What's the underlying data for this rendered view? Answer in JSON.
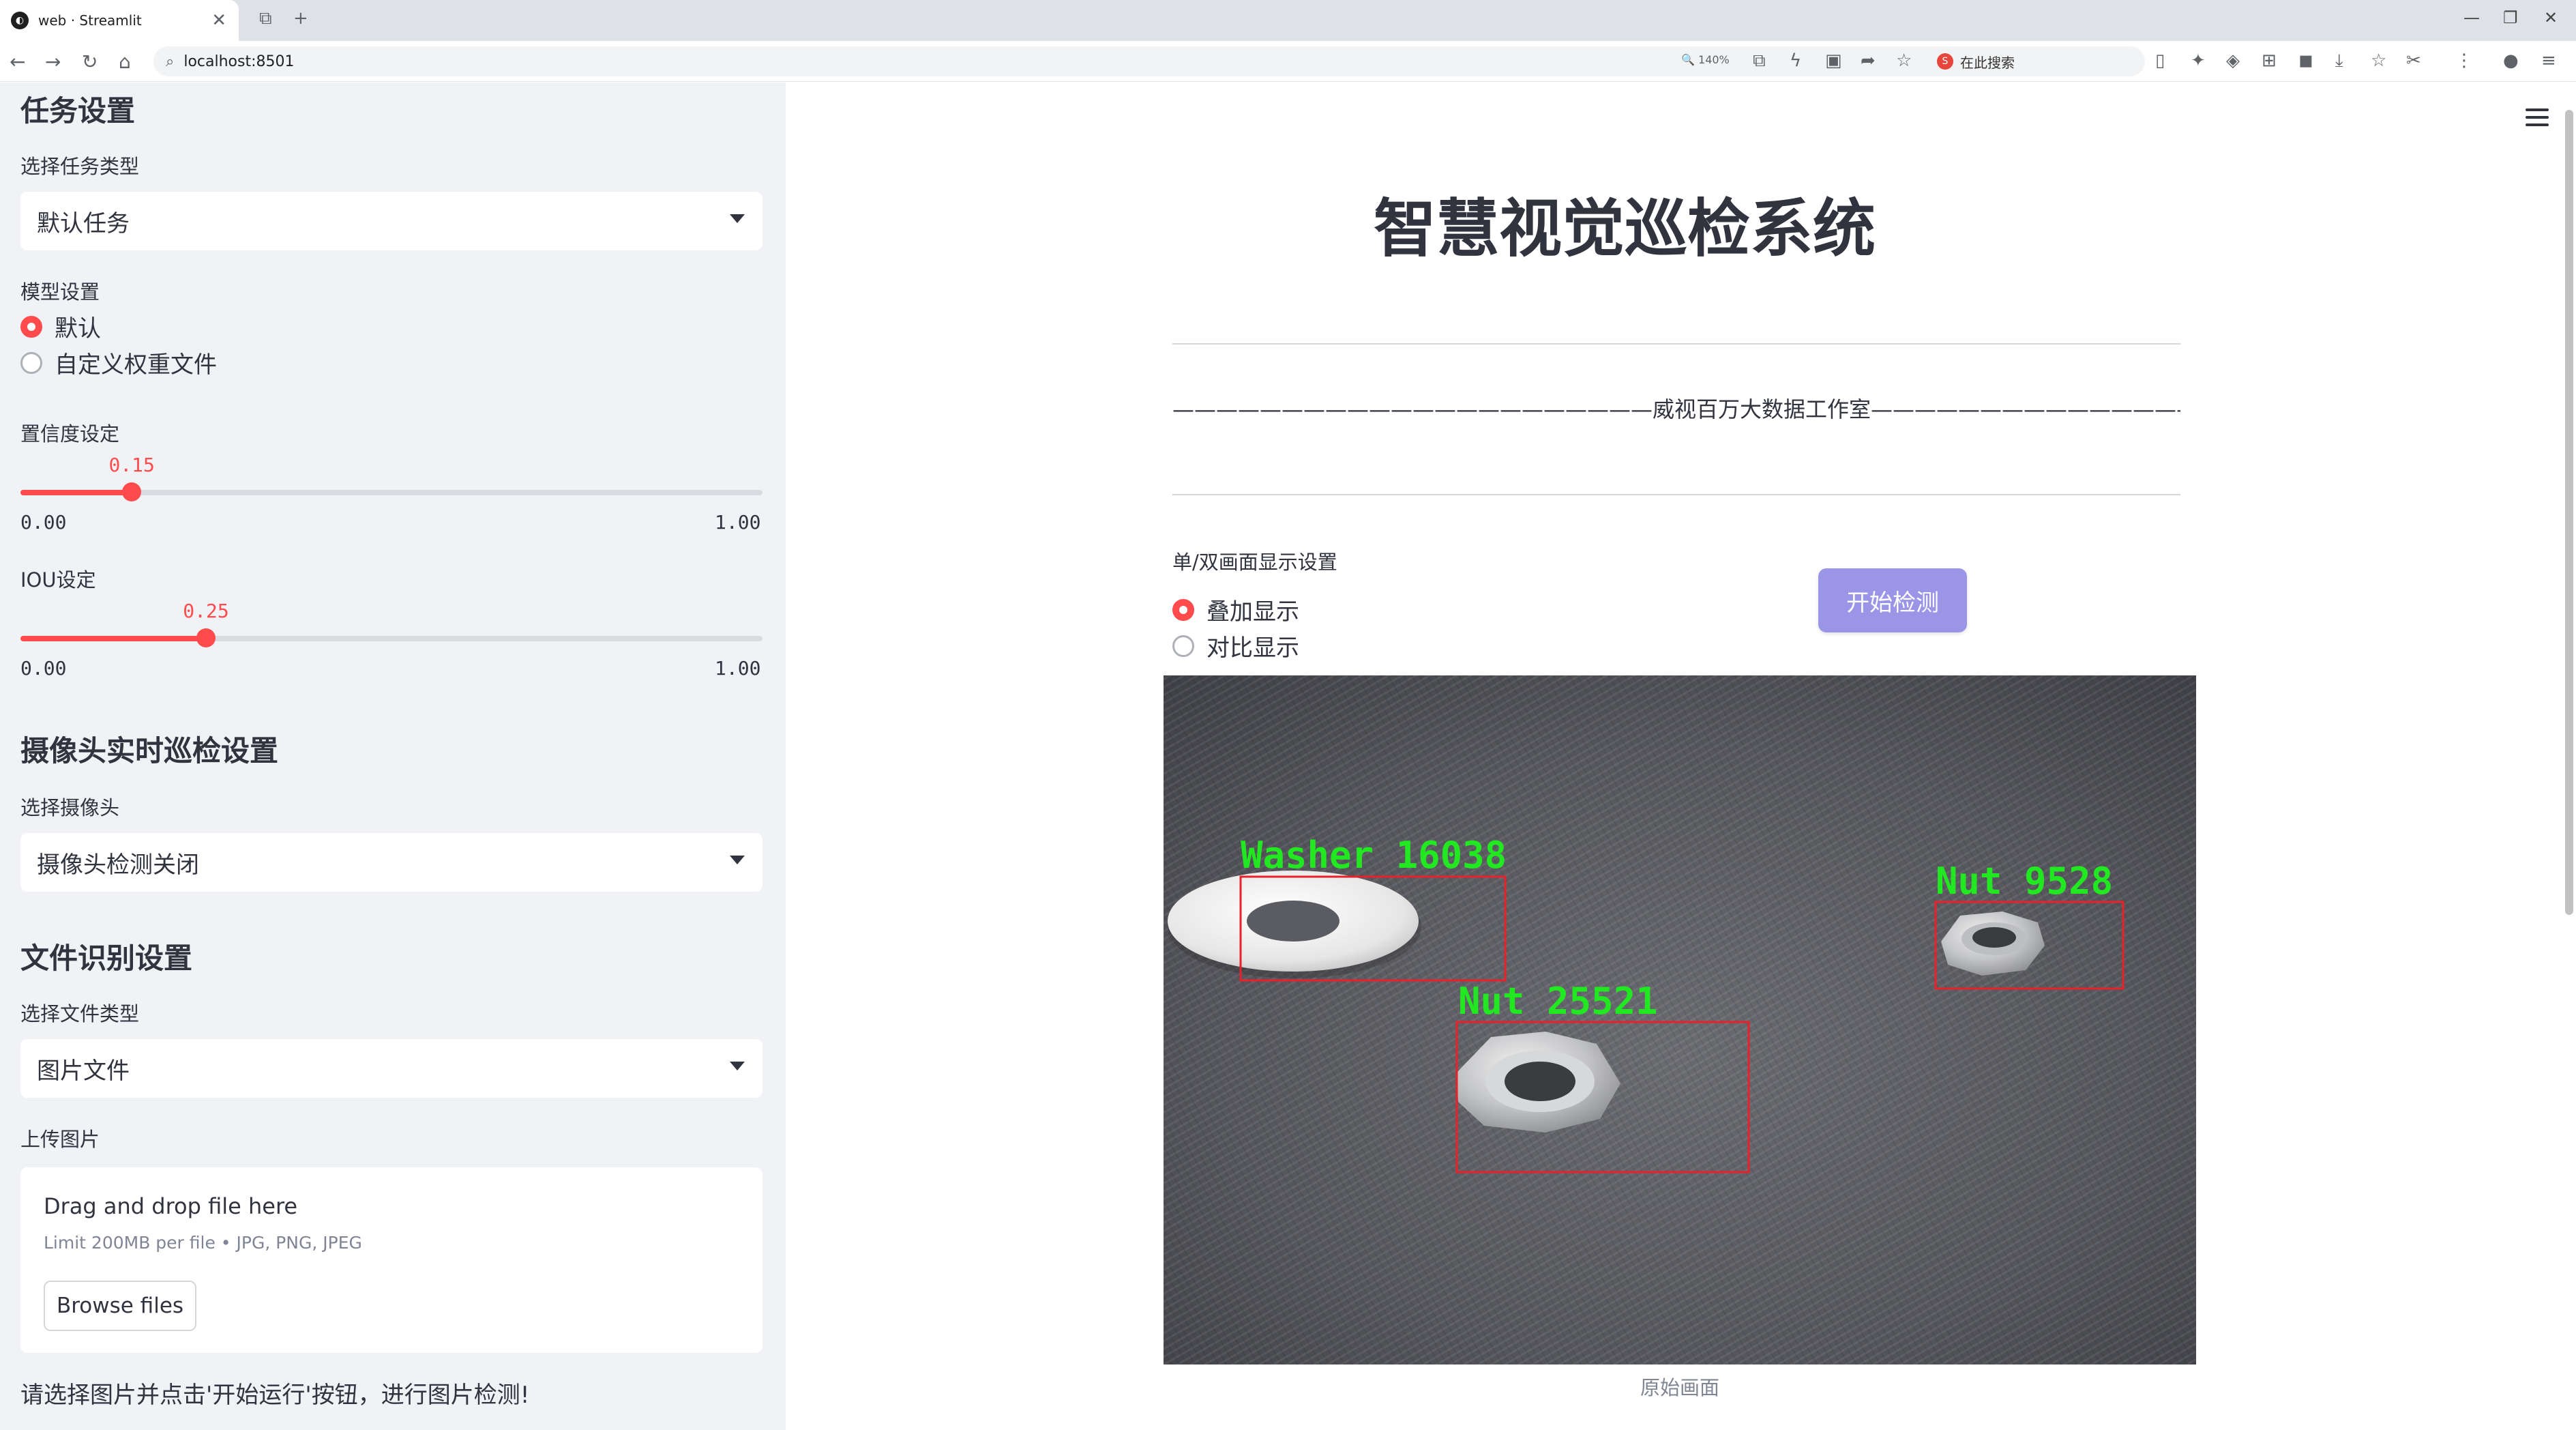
{
  "browser": {
    "tab_title": "web · Streamlit",
    "tab_logo": "◐",
    "url": "localhost:8501",
    "zoom": "140%",
    "search_placeholder": "在此搜索",
    "search_logo": "S"
  },
  "sidebar": {
    "task_section": "任务设置",
    "task_type_label": "选择任务类型",
    "task_type_value": "默认任务",
    "model_label": "模型设置",
    "model_options": [
      "默认",
      "自定义权重文件"
    ],
    "model_selected": 0,
    "conf_label": "置信度设定",
    "conf_value": 0.15,
    "conf_value_text": "0.15",
    "conf_min": "0.00",
    "conf_max": "1.00",
    "iou_label": "IOU设定",
    "iou_value": 0.25,
    "iou_value_text": "0.25",
    "iou_min": "0.00",
    "iou_max": "1.00",
    "camera_section": "摄像头实时巡检设置",
    "camera_label": "选择摄像头",
    "camera_value": "摄像头检测关闭",
    "file_section": "文件识别设置",
    "file_type_label": "选择文件类型",
    "file_type_value": "图片文件",
    "upload_label": "上传图片",
    "dropzone_title": "Drag and drop file here",
    "dropzone_limit": "Limit 200MB per file • JPG, PNG, JPEG",
    "browse_label": "Browse files",
    "hint": "请选择图片并点击'开始运行'按钮，进行图片检测!"
  },
  "main": {
    "title": "智慧视觉巡检系统",
    "subtitle": "——————————————————————威视百万大数据工作室———————————————————————",
    "display_label": "单/双画面显示设置",
    "display_options": [
      "叠加显示",
      "对比显示"
    ],
    "display_selected": 0,
    "start_button": "开始检测",
    "caption": "原始画面",
    "detections": [
      {
        "label": "Washer 16038"
      },
      {
        "label": "Nut 9528"
      },
      {
        "label": "Nut 25521"
      }
    ]
  },
  "colors": {
    "accent": "#ff4b4b",
    "button": "#9b95e8",
    "detection_box": "#e8212a",
    "detection_text": "#22e822"
  }
}
